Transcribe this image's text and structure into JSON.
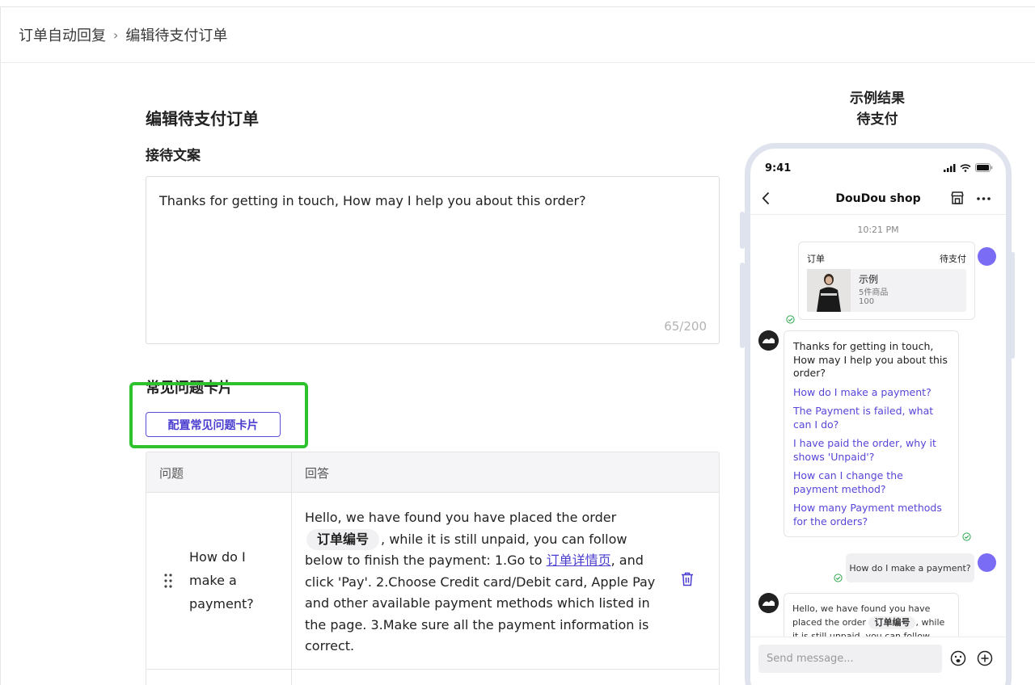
{
  "breadcrumb": {
    "parent": "订单自动回复",
    "separator": "›",
    "current": "编辑待支付订单"
  },
  "page_title": "编辑待支付订单",
  "reception": {
    "title": "接待文案",
    "text": "Thanks for getting in touch, How may I help you about this order?",
    "counter": "65/200"
  },
  "faq": {
    "title": "常见问题卡片",
    "config_button": "配置常见问题卡片",
    "headers": {
      "question": "问题",
      "answer": "回答"
    },
    "rows": [
      {
        "question": "How do I make a payment?",
        "answer_part1": "Hello, we have found you have placed the order",
        "answer_chip": "订单编号",
        "answer_part2": ", while it is still unpaid, you can follow below to finish the payment: 1.Go to",
        "answer_link": "订单详情页",
        "answer_part3": ", and click 'Pay'. 2.Choose Credit card/Debit card, Apple Pay and other available payment methods which listed in the page. 3.Make sure all the payment information is correct."
      }
    ]
  },
  "example": {
    "title_line1": "示例结果",
    "title_line2": "待支付"
  },
  "phone": {
    "time": "9:41",
    "shop_name": "DouDou shop",
    "chat_time": "10:21 PM",
    "order_card": {
      "label": "订单",
      "status": "待支付",
      "product_name": "示例",
      "product_count": "5件商品",
      "product_price": "100"
    },
    "reply": {
      "greeting": "Thanks for getting in touch, How may I help you about this order?",
      "links": [
        "How do I make a payment?",
        "The Payment is failed, what can I do?",
        "I have paid the order, why it shows 'Unpaid'?",
        "How can I change the payment method?",
        "How many Payment methods for the orders?"
      ]
    },
    "user_question": "How do I make a payment?",
    "answer_part1": "Hello, we have found you have placed the order",
    "answer_chip": "订单编号",
    "answer_part2": ", while it is still unpaid, you can follow below to",
    "input_placeholder": "Send message..."
  },
  "colors": {
    "accent": "#5646d8",
    "highlight": "#2ec22e",
    "avatar": "#7a6cf5"
  }
}
